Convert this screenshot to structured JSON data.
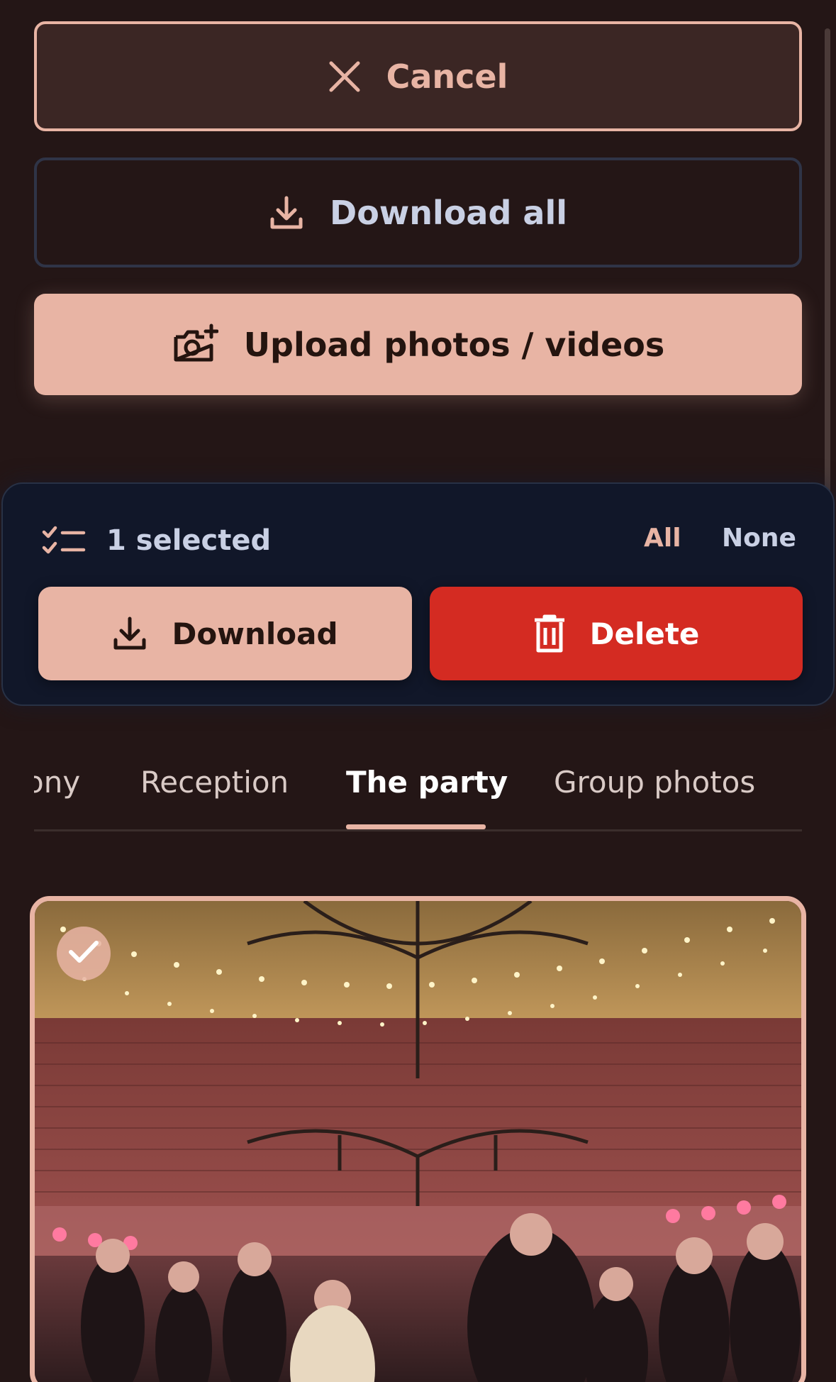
{
  "actions": {
    "cancel_label": "Cancel",
    "download_all_label": "Download all",
    "upload_label": "Upload photos / videos"
  },
  "selection": {
    "count_text": "1 selected",
    "all_label": "All",
    "none_label": "None",
    "download_label": "Download",
    "delete_label": "Delete"
  },
  "tabs": [
    {
      "label": "ony",
      "active": false
    },
    {
      "label": "Reception",
      "active": false
    },
    {
      "label": "The party",
      "active": true
    },
    {
      "label": "Group photos",
      "active": false
    }
  ],
  "colors": {
    "background": "#241616",
    "accent": "#e8b4a4",
    "panel": "#111729",
    "danger": "#d42b22"
  },
  "icons": {
    "cancel": "close-icon",
    "download_all": "download-icon",
    "upload": "camera-plus-icon",
    "selection": "checklist-icon",
    "download": "download-icon",
    "delete": "trash-icon",
    "selected_photo": "check-icon"
  }
}
